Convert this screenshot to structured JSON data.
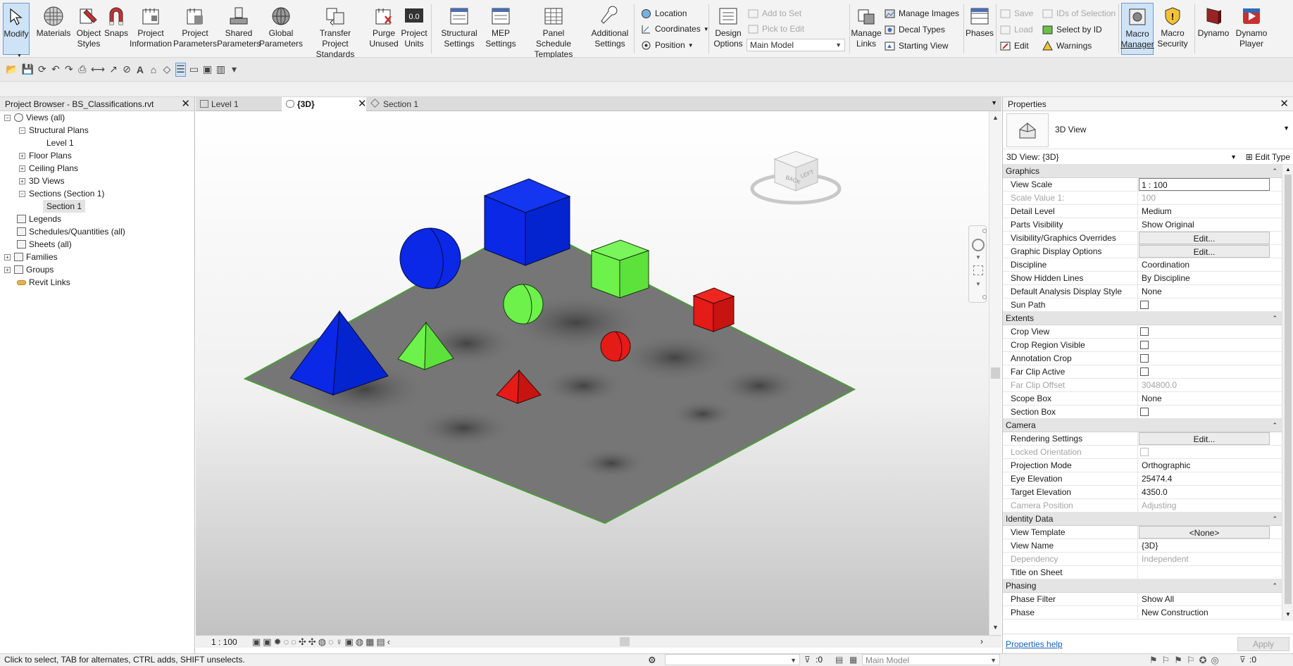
{
  "ribbon": {
    "modify": "Modify",
    "materials": "Materials",
    "object_styles_1": "Object",
    "object_styles_2": "Styles",
    "snaps": "Snaps",
    "project_information_1": "Project",
    "project_information_2": "Information",
    "project_parameters_1": "Project",
    "project_parameters_2": "Parameters",
    "shared_parameters_1": "Shared",
    "shared_parameters_2": "Parameters",
    "global_parameters_1": "Global",
    "global_parameters_2": "Parameters",
    "transfer_standards_1": "Transfer",
    "transfer_standards_2": "Project Standards",
    "purge_unused_1": "Purge",
    "purge_unused_2": "Unused",
    "project_units_1": "Project",
    "project_units_2": "Units",
    "structural_settings_1": "Structural",
    "structural_settings_2": "Settings",
    "mep_settings_1": "MEP",
    "mep_settings_2": "Settings",
    "panel_templates_1": "Panel Schedule",
    "panel_templates_2": "Templates",
    "additional_settings_1": "Additional",
    "additional_settings_2": "Settings",
    "location": "Location",
    "coordinates": "Coordinates",
    "position": "Position",
    "design_options_1": "Design",
    "design_options_2": "Options",
    "add_to_set": "Add to Set",
    "pick_to_edit": "Pick to Edit",
    "main_model": "Main Model",
    "manage_links_1": "Manage",
    "manage_links_2": "Links",
    "manage_images": "Manage  Images",
    "decal_types": "Decal  Types",
    "starting_view": "Starting  View",
    "phases": "Phases",
    "save": "Save",
    "load": "Load",
    "edit": "Edit",
    "ids_of_selection": "IDs of  Selection",
    "select_by_id": "Select  by ID",
    "warnings": "Warnings",
    "macro_manager_1": "Macro",
    "macro_manager_2": "Manager",
    "macro_security_1": "Macro",
    "macro_security_2": "Security",
    "dynamo": "Dynamo",
    "dynamo_player_1": "Dynamo",
    "dynamo_player_2": "Player"
  },
  "project_browser": {
    "title": "Project Browser - BS_Classifications.rvt",
    "items": [
      {
        "label": "Views (all)"
      },
      {
        "label": "Structural Plans"
      },
      {
        "label": "Level 1"
      },
      {
        "label": "Floor Plans"
      },
      {
        "label": "Ceiling Plans"
      },
      {
        "label": "3D Views"
      },
      {
        "label": "Sections (Section 1)"
      },
      {
        "label": "Section 1"
      },
      {
        "label": "Legends"
      },
      {
        "label": "Schedules/Quantities (all)"
      },
      {
        "label": "Sheets (all)"
      },
      {
        "label": "Families"
      },
      {
        "label": "Groups"
      },
      {
        "label": "Revit Links"
      }
    ]
  },
  "view_tabs": {
    "level1": "Level 1",
    "threed": "{3D}",
    "section1": "Section 1"
  },
  "viewcube": {
    "back": "BACK",
    "left": "LEFT"
  },
  "view_bar": {
    "scale": "1 : 100"
  },
  "properties": {
    "title": "Properties",
    "type_label": "3D View",
    "selector": "3D View: {3D}",
    "edit_type": "Edit Type",
    "groups": [
      {
        "name": "Graphics",
        "rows": [
          {
            "key": "View Scale",
            "value": "1 : 100"
          },
          {
            "key": "Scale Value    1:",
            "value": "100"
          },
          {
            "key": "Detail Level",
            "value": "Medium"
          },
          {
            "key": "Parts Visibility",
            "value": "Show Original"
          },
          {
            "key": "Visibility/Graphics Overrides",
            "value": "Edit..."
          },
          {
            "key": "Graphic Display Options",
            "value": "Edit..."
          },
          {
            "key": "Discipline",
            "value": "Coordination"
          },
          {
            "key": "Show Hidden Lines",
            "value": "By Discipline"
          },
          {
            "key": "Default Analysis Display Style",
            "value": "None"
          },
          {
            "key": "Sun Path",
            "value": ""
          }
        ]
      },
      {
        "name": "Extents",
        "rows": [
          {
            "key": "Crop View",
            "value": ""
          },
          {
            "key": "Crop Region Visible",
            "value": ""
          },
          {
            "key": "Annotation Crop",
            "value": ""
          },
          {
            "key": "Far Clip Active",
            "value": ""
          },
          {
            "key": "Far Clip Offset",
            "value": "304800.0"
          },
          {
            "key": "Scope Box",
            "value": "None"
          },
          {
            "key": "Section Box",
            "value": ""
          }
        ]
      },
      {
        "name": "Camera",
        "rows": [
          {
            "key": "Rendering Settings",
            "value": "Edit..."
          },
          {
            "key": "Locked Orientation",
            "value": ""
          },
          {
            "key": "Projection Mode",
            "value": "Orthographic"
          },
          {
            "key": "Eye Elevation",
            "value": "25474.4"
          },
          {
            "key": "Target Elevation",
            "value": "4350.0"
          },
          {
            "key": "Camera Position",
            "value": "Adjusting"
          }
        ]
      },
      {
        "name": "Identity Data",
        "rows": [
          {
            "key": "View Template",
            "value": "<None>"
          },
          {
            "key": "View Name",
            "value": "{3D}"
          },
          {
            "key": "Dependency",
            "value": "Independent"
          },
          {
            "key": "Title on Sheet",
            "value": ""
          }
        ]
      },
      {
        "name": "Phasing",
        "rows": [
          {
            "key": "Phase Filter",
            "value": "Show All"
          },
          {
            "key": "Phase",
            "value": "New Construction"
          }
        ]
      }
    ],
    "help": "Properties help",
    "apply": "Apply"
  },
  "status_bar": {
    "message": "Click to select, TAB for alternates, CTRL adds, SHIFT unselects.",
    "filter_count": ":0",
    "model": "Main Model",
    "selection_count": ":0"
  },
  "colors": {
    "accent": "#cfe3f7",
    "blue": "#0a28e6",
    "green": "#6cf24a",
    "red": "#e41b17",
    "floor": "#767676"
  }
}
